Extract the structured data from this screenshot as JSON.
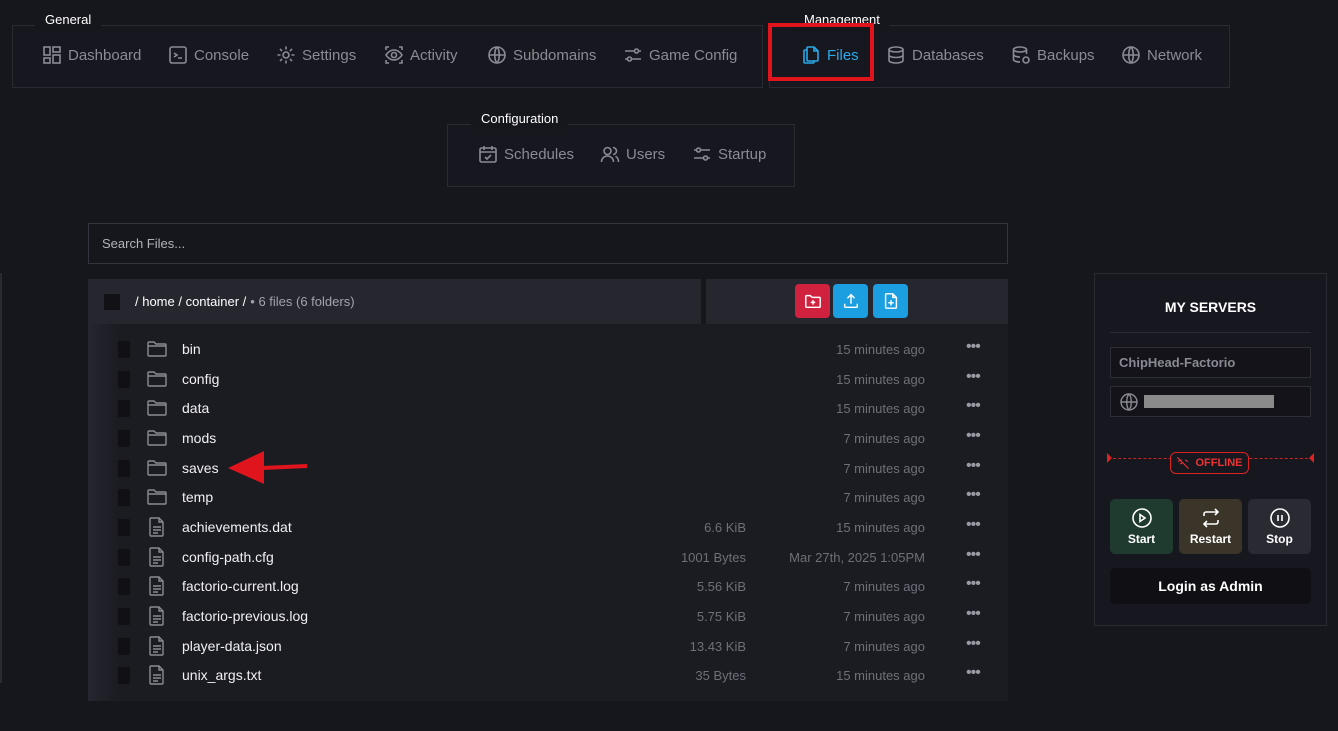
{
  "nav": {
    "general": {
      "label": "General",
      "items": [
        {
          "label": "Dashboard",
          "icon": "dashboard-icon"
        },
        {
          "label": "Console",
          "icon": "console-icon"
        },
        {
          "label": "Settings",
          "icon": "gear-icon"
        },
        {
          "label": "Activity",
          "icon": "eye-icon"
        },
        {
          "label": "Subdomains",
          "icon": "globe-icon"
        },
        {
          "label": "Game Config",
          "icon": "sliders-icon"
        }
      ]
    },
    "management": {
      "label": "Management",
      "items": [
        {
          "label": "Files",
          "icon": "files-icon",
          "active": true
        },
        {
          "label": "Databases",
          "icon": "database-icon"
        },
        {
          "label": "Backups",
          "icon": "backup-icon"
        },
        {
          "label": "Network",
          "icon": "globe-icon"
        }
      ]
    },
    "configuration": {
      "label": "Configuration",
      "items": [
        {
          "label": "Schedules",
          "icon": "calendar-icon"
        },
        {
          "label": "Users",
          "icon": "users-icon"
        },
        {
          "label": "Startup",
          "icon": "sliders-icon"
        }
      ]
    }
  },
  "search": {
    "placeholder": "Search Files..."
  },
  "breadcrumb": {
    "path": "/ home / container /",
    "count": "• 6 files (6 folders)"
  },
  "actions": [
    {
      "name": "new-folder",
      "color": "#d0213f"
    },
    {
      "name": "upload",
      "color": "#1c9fe0"
    },
    {
      "name": "new-file",
      "color": "#1c9fe0"
    }
  ],
  "files": [
    {
      "name": "bin",
      "type": "folder",
      "size": "",
      "modified": "15 minutes ago"
    },
    {
      "name": "config",
      "type": "folder",
      "size": "",
      "modified": "15 minutes ago"
    },
    {
      "name": "data",
      "type": "folder",
      "size": "",
      "modified": "15 minutes ago"
    },
    {
      "name": "mods",
      "type": "folder",
      "size": "",
      "modified": "7 minutes ago"
    },
    {
      "name": "saves",
      "type": "folder",
      "size": "",
      "modified": "7 minutes ago"
    },
    {
      "name": "temp",
      "type": "folder",
      "size": "",
      "modified": "7 minutes ago"
    },
    {
      "name": "achievements.dat",
      "type": "file",
      "size": "6.6 KiB",
      "modified": "15 minutes ago"
    },
    {
      "name": "config-path.cfg",
      "type": "file",
      "size": "1001 Bytes",
      "modified": "Mar 27th, 2025 1:05PM"
    },
    {
      "name": "factorio-current.log",
      "type": "file",
      "size": "5.56 KiB",
      "modified": "7 minutes ago"
    },
    {
      "name": "factorio-previous.log",
      "type": "file",
      "size": "5.75 KiB",
      "modified": "7 minutes ago"
    },
    {
      "name": "player-data.json",
      "type": "file",
      "size": "13.43 KiB",
      "modified": "7 minutes ago"
    },
    {
      "name": "unix_args.txt",
      "type": "file",
      "size": "35 Bytes",
      "modified": "15 minutes ago"
    }
  ],
  "more_glyph": "•••",
  "servers": {
    "title": "MY SERVERS",
    "server_name": "ChipHead-Factorio",
    "status": "OFFLINE",
    "status_color": "#e33",
    "buttons": [
      {
        "label": "Start",
        "color": "#1f3b2f"
      },
      {
        "label": "Restart",
        "color": "#3a3528"
      },
      {
        "label": "Stop",
        "color": "#2a2a33"
      }
    ],
    "login_label": "Login as Admin"
  }
}
